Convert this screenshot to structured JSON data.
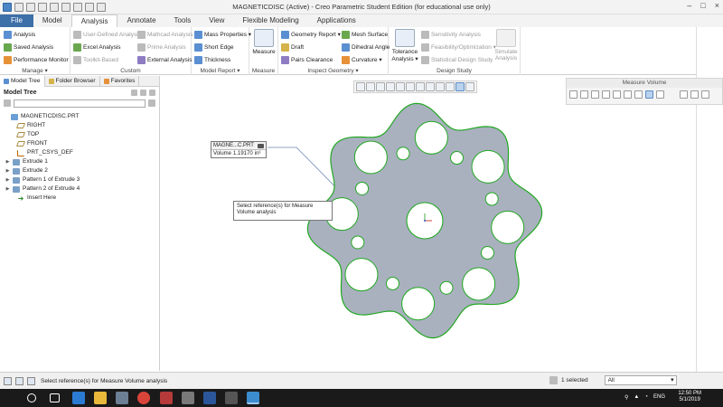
{
  "window": {
    "title": "MAGNETICDISC (Active) - Creo Parametric Student Edition (for educational use only)"
  },
  "tabs": [
    "File",
    "Model",
    "Analysis",
    "Annotate",
    "Tools",
    "View",
    "Flexible Modeling",
    "Applications"
  ],
  "ribbon": {
    "manage": {
      "caption": "Manage ▾",
      "analysis": "Analysis",
      "saved": "Saved Analysis",
      "perf": "Performance Monitor"
    },
    "custom": {
      "caption": "Custom",
      "user_defined": "User-Defined Analysis",
      "mathcad": "Mathcad Analysis",
      "excel": "Excel Analysis",
      "prime": "Prime Analysis",
      "toolkit": "Toolkit-Based",
      "external": "External Analysis"
    },
    "model_report": {
      "caption": "Model Report ▾",
      "mass": "Mass Properties ▾",
      "short_edge": "Short Edge",
      "thickness": "Thickness"
    },
    "measure": {
      "caption": "Measure",
      "label": "Measure"
    },
    "inspect": {
      "caption": "Inspect Geometry ▾",
      "geometry_report": "Geometry Report ▾",
      "mesh": "Mesh Surface",
      "draft": "Draft",
      "dihedral": "Dihedral Angle",
      "pairs": "Pairs Clearance",
      "curvature": "Curvature ▾"
    },
    "design_study": {
      "caption": "Design Study",
      "tolerance": "Tolerance Analysis ▾",
      "sensitivity": "Sensitivity Analysis",
      "feasibility": "Feasibility/Optimization ▾",
      "statistical": "Statistical Design Study",
      "simulate": "Simulate Analysis"
    }
  },
  "left_panel": {
    "tabs": [
      "Model Tree",
      "Folder Browser",
      "Favorites"
    ],
    "header": "Model Tree",
    "items": [
      {
        "label": "MAGNETICDISC.PRT",
        "type": "part",
        "expand": ""
      },
      {
        "label": "RIGHT",
        "type": "plane",
        "expand": ""
      },
      {
        "label": "TOP",
        "type": "plane",
        "expand": ""
      },
      {
        "label": "FRONT",
        "type": "plane",
        "expand": ""
      },
      {
        "label": "PRT_CSYS_DEF",
        "type": "csys",
        "expand": ""
      },
      {
        "label": "Extrude 1",
        "type": "ext",
        "expand": "▶"
      },
      {
        "label": "Extrude 2",
        "type": "ext",
        "expand": "▶"
      },
      {
        "label": "Pattern 1 of Extrude 3",
        "type": "ext",
        "expand": "▶"
      },
      {
        "label": "Pattern 2 of Extrude 4",
        "type": "ext",
        "expand": "▶"
      },
      {
        "label": "Insert Here",
        "type": "ins",
        "expand": ""
      }
    ]
  },
  "measure_volume": {
    "title": "Measure Volume"
  },
  "callout": {
    "title": "MAGNE...C.PRT",
    "label": "Volume",
    "value": "1.19170",
    "unit": "in³"
  },
  "tooltip": {
    "text": "Select reference(s) for Measure Volume analysis"
  },
  "status": {
    "message": "Select reference(s) for Measure Volume analysis",
    "selected": "1 selected",
    "filter": "All"
  },
  "taskbar": {
    "time": "12:50 PM",
    "date": "5/1/2019",
    "lang": "ENG"
  },
  "colors": {
    "accent": "#3d6fa8",
    "part_fill": "#a9b1bf",
    "edge": "#22a822"
  }
}
